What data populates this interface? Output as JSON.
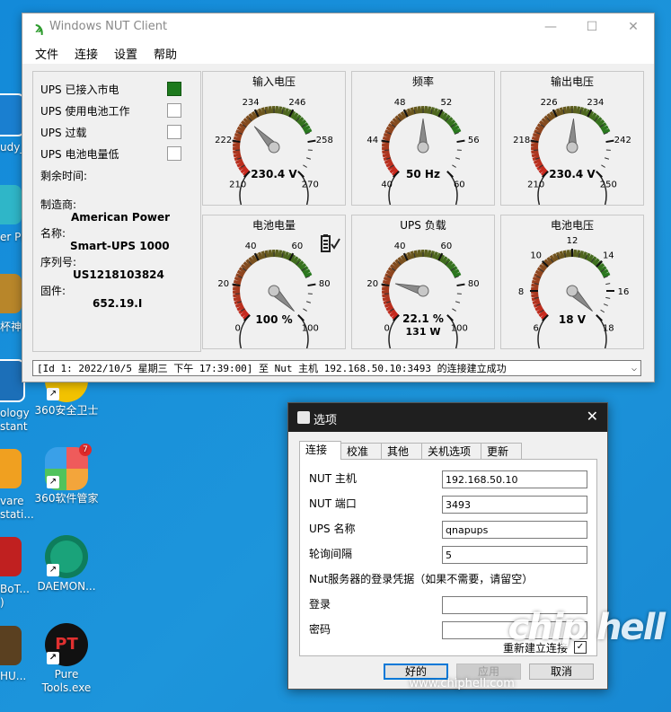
{
  "window": {
    "title": "Windows NUT Client",
    "menu": [
      "文件",
      "连接",
      "设置",
      "帮助"
    ]
  },
  "status": {
    "items": [
      {
        "label": "UPS 已接入市电",
        "on": true
      },
      {
        "label": "UPS 使用电池工作",
        "on": false
      },
      {
        "label": "UPS 过载",
        "on": false
      },
      {
        "label": "UPS 电池电量低",
        "on": false
      }
    ],
    "remaining_label": "剩余时间:",
    "manufacturer_label": "制造商:",
    "manufacturer": "American Power",
    "name_label": "名称:",
    "name": "Smart-UPS 1000",
    "serial_label": "序列号:",
    "serial": "US1218103824",
    "firmware_label": "固件:",
    "firmware": "652.19.I"
  },
  "gauges": [
    {
      "title": "输入电压",
      "ticks": [
        "210",
        "222",
        "234",
        "246",
        "258",
        "270"
      ],
      "min": 210,
      "max": 270,
      "value": 230.4,
      "readout": "230.4 V",
      "readout2": "",
      "icon": ""
    },
    {
      "title": "频率",
      "ticks": [
        "40",
        "44",
        "48",
        "52",
        "56",
        "60"
      ],
      "min": 40,
      "max": 60,
      "value": 50,
      "readout": "50 Hz",
      "readout2": "",
      "icon": ""
    },
    {
      "title": "输出电压",
      "ticks": [
        "210",
        "218",
        "226",
        "234",
        "242",
        "250"
      ],
      "min": 210,
      "max": 250,
      "value": 230.4,
      "readout": "230.4 V",
      "readout2": "",
      "icon": ""
    },
    {
      "title": "电池电量",
      "ticks": [
        "0",
        "20",
        "40",
        "60",
        "80",
        "100"
      ],
      "min": 0,
      "max": 100,
      "value": 100,
      "readout": "100 %",
      "readout2": "",
      "icon": "battery-check-icon"
    },
    {
      "title": "UPS 负载",
      "ticks": [
        "0",
        "20",
        "40",
        "60",
        "80",
        "100"
      ],
      "min": 0,
      "max": 100,
      "value": 22.1,
      "readout": "22.1 %",
      "readout2": "131 W",
      "icon": ""
    },
    {
      "title": "电池电压",
      "ticks": [
        "6",
        "8",
        "10",
        "12",
        "14",
        "16",
        "18"
      ],
      "min": 6,
      "max": 18,
      "value": 18,
      "readout": "18 V",
      "readout2": "",
      "icon": ""
    }
  ],
  "log": "[Id 1: 2022/10/5 星期三 下午 17:39:00] 至 Nut 主机 192.168.50.10:3493 的连接建立成功",
  "dialog": {
    "title": "选项",
    "tabs": [
      "连接",
      "校准",
      "其他",
      "关机选项",
      "更新"
    ],
    "fields": [
      {
        "label": "NUT 主机",
        "value": "192.168.50.10"
      },
      {
        "label": "NUT 端口",
        "value": "3493"
      },
      {
        "label": "UPS 名称",
        "value": "qnapups"
      },
      {
        "label": "轮询间隔",
        "value": "5"
      }
    ],
    "credentials_note": "Nut服务器的登录凭据（如果不需要，请留空）",
    "login_label": "登录",
    "login_value": "",
    "password_label": "密码",
    "password_value": "",
    "reconnect_label": "重新建立连接",
    "reconnect_checked": true,
    "ok": "好的",
    "apply": "应用",
    "cancel": "取消"
  },
  "desktop": {
    "icons": [
      {
        "label": "360安全卫士",
        "color": "#f2c200"
      },
      {
        "label": "360软件管家",
        "color": "#f3a53b"
      },
      {
        "label": "DAEMON...",
        "color": "#1aa37a"
      },
      {
        "label": "Pure\nTools.exe",
        "color": "#111111"
      }
    ],
    "edge_labels": [
      "udy_",
      "er Pr",
      "杯神",
      "ology\nstant",
      "vare\nstati...",
      "BoT...\n)",
      "HU..."
    ],
    "watermark": "chip hell",
    "watermark_url": "www.chiphell.com"
  },
  "colors": {
    "accent": "#0078d7",
    "status_on": "#1e7a1e",
    "desktop": "#1a8fd6"
  }
}
